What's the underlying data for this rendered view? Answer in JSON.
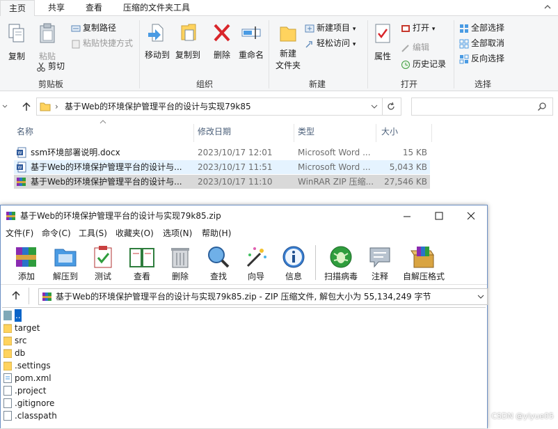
{
  "ribbon_tabs": [
    "主页",
    "共享",
    "查看",
    "压缩的文件夹工具"
  ],
  "clipboard": {
    "copy": "复制",
    "paste": "粘贴",
    "copy_path": "复制路径",
    "paste_shortcut": "粘贴快捷方式",
    "cut": "剪切",
    "label": "剪贴板"
  },
  "organize": {
    "move_to": "移动到",
    "copy_to": "复制到",
    "delete": "删除",
    "rename": "重命名",
    "label": "组织"
  },
  "new_group": {
    "new_folder_l1": "新建",
    "new_folder_l2": "文件夹",
    "new_item": "新建项目",
    "easy_access": "轻松访问",
    "label": "新建"
  },
  "open_group": {
    "properties": "属性",
    "open": "打开",
    "edit": "编辑",
    "history": "历史记录",
    "label": "打开"
  },
  "select_group": {
    "select_all": "全部选择",
    "select_none": "全部取消",
    "invert": "反向选择",
    "label": "选择"
  },
  "address": {
    "path": "基于Web的环境保护管理平台的设计与实现79k85"
  },
  "columns": {
    "name": "名称",
    "date": "修改日期",
    "type": "类型",
    "size": "大小"
  },
  "files": [
    {
      "name": "ssm环境部署说明.docx",
      "date": "2023/10/17 12:01",
      "type": "Microsoft Word ...",
      "size": "15 KB",
      "icon": "word-icon"
    },
    {
      "name": "基于Web的环境保护管理平台的设计与...",
      "date": "2023/10/17 11:51",
      "type": "Microsoft Word ...",
      "size": "5,043 KB",
      "icon": "word-icon"
    },
    {
      "name": "基于Web的环境保护管理平台的设计与...",
      "date": "2023/10/17 11:10",
      "type": "WinRAR ZIP 压缩...",
      "size": "27,546 KB",
      "icon": "rar-icon"
    }
  ],
  "rar": {
    "title": "基于Web的环境保护管理平台的设计与实现79k85.zip",
    "menu": [
      "文件(F)",
      "命令(C)",
      "工具(S)",
      "收藏夹(O)",
      "选项(N)",
      "帮助(H)"
    ],
    "tools": [
      "添加",
      "解压到",
      "测试",
      "查看",
      "删除",
      "查找",
      "向导",
      "信息",
      "扫描病毒",
      "注释",
      "自解压格式"
    ],
    "path": "基于Web的环境保护管理平台的设计与实现79k85.zip - ZIP 压缩文件, 解包大小为 55,134,249 字节",
    "items": [
      {
        "name": "..",
        "kind": "up"
      },
      {
        "name": "target",
        "kind": "folder"
      },
      {
        "name": "src",
        "kind": "folder"
      },
      {
        "name": "db",
        "kind": "folder"
      },
      {
        "name": ".settings",
        "kind": "folder"
      },
      {
        "name": "pom.xml",
        "kind": "xml"
      },
      {
        "name": ".project",
        "kind": "file"
      },
      {
        "name": ".gitignore",
        "kind": "file"
      },
      {
        "name": ".classpath",
        "kind": "file"
      }
    ]
  },
  "watermark": "CSDN @yiyue05",
  "colors": {
    "accent": "#0078d7",
    "selected_row": "#cce8ff",
    "highlight_row": "#d9d9d9",
    "folder": "#ffd35e"
  }
}
